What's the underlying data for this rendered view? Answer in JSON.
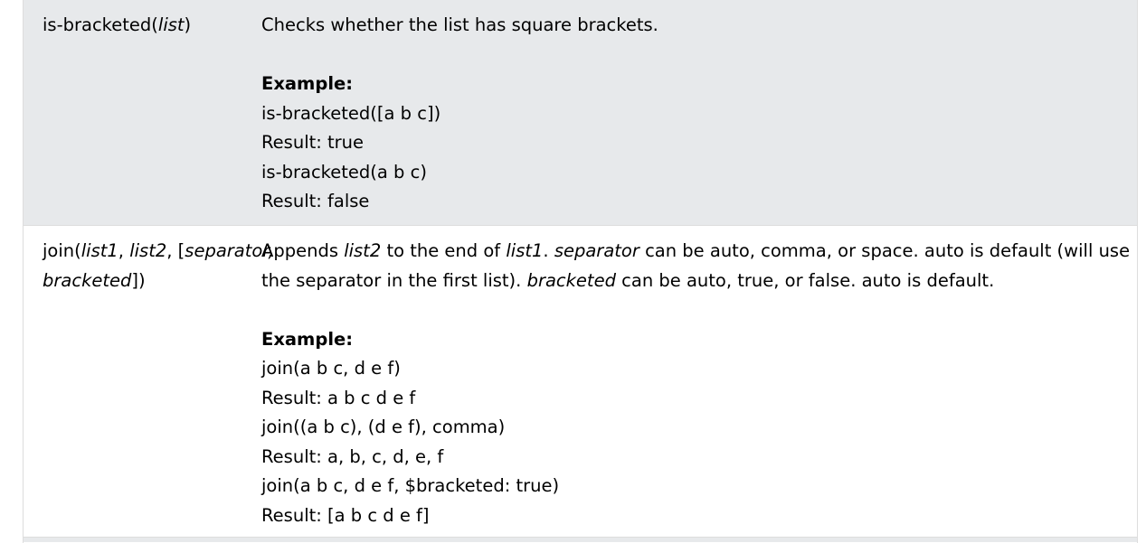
{
  "rows": [
    {
      "func": {
        "name": "is-bracketed(",
        "arg": "list",
        "close": ")"
      },
      "description": "Checks whether the list has square brackets.",
      "example_heading": "Example:",
      "examples": [
        "is-bracketed([a b c])",
        "Result: true",
        "is-bracketed(a b c)",
        "Result: false"
      ]
    },
    {
      "func": {
        "name": "join(",
        "arg1": "list1",
        "sep1": ", ",
        "arg2": "list2",
        "sep2": ", [",
        "arg3": "separator,",
        "arg4": "bracketed",
        "close": "])"
      },
      "description": {
        "p1_arg": "list2",
        "p1_a": "Appends ",
        "p1_b": " to the end of ",
        "p1_arg2": "list1",
        "p1_c": ". ",
        "p1_arg3": "separator",
        "p1_d": " can be auto, comma, or space. auto is default (will use",
        "p2_a": "the separator in the first list). ",
        "p2_arg": "bracketed",
        "p2_b": " can be auto, true, or false. auto is default."
      },
      "example_heading": "Example:",
      "examples": [
        "join(a b c, d e f)",
        "Result: a b c d e f",
        "join((a b c), (d e f), comma)",
        "Result: a, b, c, d, e, f",
        "join(a b c, d e f, $bracketed: true)",
        "Result: [a b c d e f]"
      ]
    }
  ]
}
